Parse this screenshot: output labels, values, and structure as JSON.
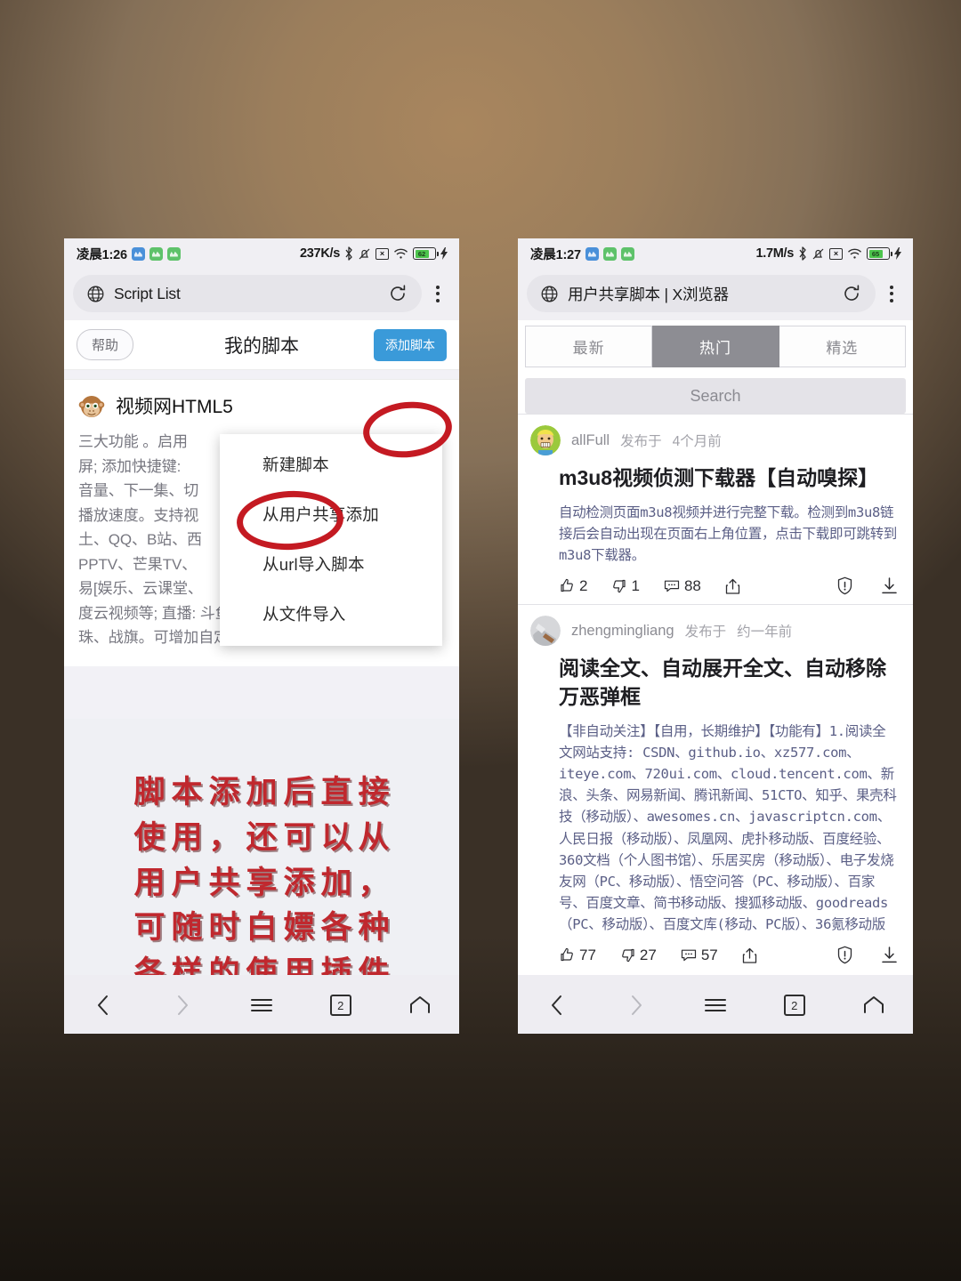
{
  "background": {
    "accent_red": "#c0282e",
    "accent_blue": "#3a9ad9"
  },
  "left_phone": {
    "status_bar": {
      "time": "凌晨1:26",
      "net_speed": "237K/s",
      "battery_percent": "62",
      "icons": [
        "bluetooth-icon",
        "mute-bell-icon",
        "sim-off-icon",
        "wifi-icon",
        "battery-icon",
        "charging-bolt-icon"
      ]
    },
    "url_bar": {
      "title": "Script List",
      "reload_label": "刷新",
      "menu_label": "更多"
    },
    "toolbar": {
      "help_label": "帮助",
      "page_title": "我的脚本",
      "add_script_label": "添加脚本"
    },
    "script_card": {
      "title": "视频网HTML5",
      "description": "三大功能 。启用网页全屏; 添加快捷键: 音量、下一集、切换播放速度。支持视频网站: 土、QQ、B站、西瓜、PPTV、芒果TV、优酷、网易[娱乐、云课堂]、百度云视频等; 直播: 斗鱼、YY、虎牙、龙珠、战旗。可增加自定义站点",
      "description_lines": [
        "三大功能 。启用",
        "屏; 添加快捷键:",
        "音量、下一集、切",
        "播放速度。支持视",
        "土、QQ、B站、西",
        "PPTV、芒果TV、",
        "易[娱乐、云课堂、",
        "度云视频等; 直播: 斗鱼、YY、虎牙、龙",
        "珠、战旗。可增加自定义站点"
      ]
    },
    "dropdown": {
      "items": [
        {
          "label": "新建脚本"
        },
        {
          "label": "从用户共享添加"
        },
        {
          "label": "从url导入脚本"
        },
        {
          "label": "从文件导入"
        }
      ]
    },
    "poster_lines": [
      "脚本添加后直接",
      "使用，还可以从",
      "用户共享添加，",
      "可随时白嫖各种",
      "各样的使用插件"
    ],
    "bottom_nav": {
      "back_label": "后退",
      "forward_label": "前进",
      "menu_label": "菜单",
      "tab_count": "2",
      "home_label": "主页"
    }
  },
  "right_phone": {
    "status_bar": {
      "time": "凌晨1:27",
      "net_speed": "1.7M/s",
      "battery_percent": "65",
      "icons": [
        "bluetooth-icon",
        "mute-bell-icon",
        "sim-off-icon",
        "wifi-icon",
        "battery-icon",
        "charging-bolt-icon"
      ]
    },
    "url_bar": {
      "title": "用户共享脚本 | X浏览器",
      "reload_label": "刷新",
      "menu_label": "更多"
    },
    "tabs": [
      {
        "label": "最新",
        "active": false
      },
      {
        "label": "热门",
        "active": true
      },
      {
        "label": "精选",
        "active": false
      }
    ],
    "search": {
      "placeholder": "Search",
      "value": ""
    },
    "posts": [
      {
        "author": "allFull",
        "posted_prefix": "发布于",
        "posted_time": "4个月前",
        "title": "m3u8视频侦测下载器【自动嗅探】",
        "description": "自动检测页面m3u8视频并进行完整下载。检测到m3u8链接后会自动出现在页面右上角位置，点击下载即可跳转到m3u8下载器。",
        "likes": "2",
        "dislikes": "1",
        "comments": "88",
        "share_label": "分享",
        "report_label": "举报",
        "install_label": "安装"
      },
      {
        "author": "zhengmingliang",
        "posted_prefix": "发布于",
        "posted_time": "约一年前",
        "title": "阅读全文、自动展开全文、自动移除万恶弹框",
        "description": "【非自动关注】【自用，长期维护】【功能有】1.阅读全文网站支持: CSDN、github.io、xz577.com、iteye.com、720ui.com、cloud.tencent.com、新浪、头条、网易新闻、腾讯新闻、51CTO、知乎、果壳科技（移动版）、awesomes.cn、javascriptcn.com、人民日报（移动版）、凤凰网、虎扑移动版、百度经验、360文档（个人图书馆）、乐居买房（移动版）、电子发烧友网（PC、移动版）、悟空问答（PC、移动版）、百家号、百度文章、简书移动版、搜狐移动版、goodreads（PC、移动版）、百度文库(移动、PC版）、36氪移动版",
        "likes": "77",
        "dislikes": "27",
        "comments": "57",
        "share_label": "分享",
        "report_label": "举报",
        "install_label": "安装"
      }
    ],
    "bottom_nav": {
      "back_label": "后退",
      "forward_label": "前进",
      "menu_label": "菜单",
      "tab_count": "2",
      "home_label": "主页"
    }
  }
}
